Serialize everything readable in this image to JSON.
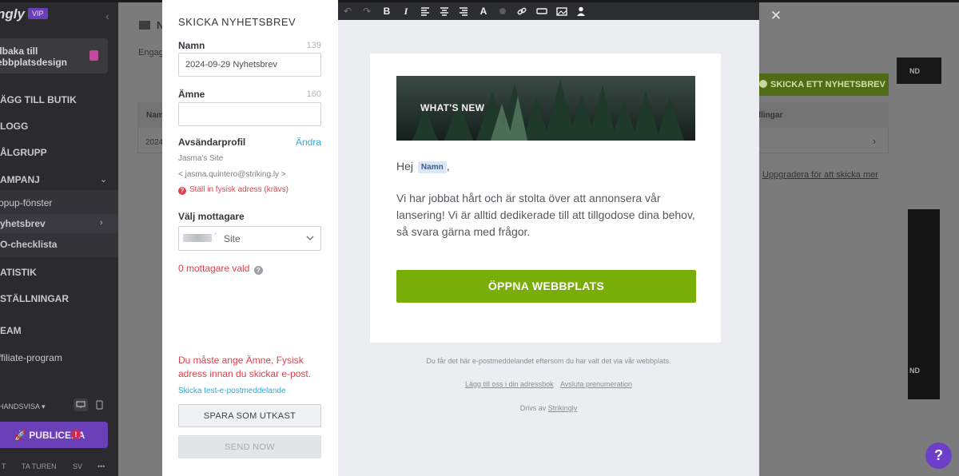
{
  "background_app": {
    "logo": "ngly",
    "vip_badge": "VIP",
    "back_label": "llbaka till ebbplatsdesign",
    "nav": {
      "add_store": "ÄGG TILL BUTIK",
      "blog": "LOGG",
      "audience": "ÅLGRUPP",
      "campaign": "AMPANJ",
      "popup": "opup-fönster",
      "newsletter": "yhetsbrev",
      "seo": "O-checklista",
      "stats": "ATISTIK",
      "settings": "STÄLLNINGAR",
      "team": "EAM",
      "affiliate": "ffiliate-program"
    },
    "preview_label": "HANDSVISA",
    "publish_label": "PUBLICERA",
    "bottom_links": [
      "T",
      "TA TUREN",
      "SV",
      "•••"
    ],
    "header_title": "N",
    "engagement_text": "Engag",
    "table_col_name": "Nam",
    "table_col_actions": "dlingar",
    "table_row_date": "2024",
    "send_newsletter_button": "SKICKA ETT NYHETSBREV",
    "upgrade_link": "Uppgradera för att skicka mer",
    "side_card_text": "ND"
  },
  "editor_toolbar": {
    "buttons": [
      "undo-icon",
      "redo-icon",
      "bold-icon",
      "italic-icon",
      "align-left-icon",
      "align-center-icon",
      "align-right-icon",
      "text-color-icon",
      "dot-icon",
      "link-icon",
      "button-icon",
      "image-icon",
      "person-icon"
    ],
    "bold": "B",
    "italic": "I",
    "font": "A"
  },
  "form": {
    "title": "SKICKA NYHETSBREV",
    "name_label": "Namn",
    "name_count": "139",
    "name_value": "2024-09-29 Nyhetsbrev",
    "subject_label": "Ämne",
    "subject_count": "160",
    "subject_value": "",
    "sender_label": "Avsändarprofil",
    "change_link": "Ändra",
    "sender_name": "Jasma's Site",
    "sender_email": "< jasma.quintero@striking.ly >",
    "address_warning": "Ställ in fysisk adress (krävs)",
    "recipients_label": "Välj mottagare",
    "recipients_select": "Site",
    "recipients_count": "0 mottagare vald",
    "error_message": "Du måste ange Ämne, Fysisk adress innan du skickar e-post.",
    "test_link": "Skicka test-e-postmeddelande",
    "save_draft": "SPARA SOM UTKAST",
    "send_now": "SEND NOW"
  },
  "email": {
    "hero_text": "WHAT'S NEW",
    "greeting": "Hej",
    "name_tag": "Namn",
    "greeting_suffix": ",",
    "body": "Vi har jobbat hårt och är stolta över att annonsera vår lansering! Vi är alltid dedikerade till att tillgodose dina behov, så svara gärna med frågor.",
    "cta": "ÖPPNA WEBBPLATS",
    "footer_note": "Du får det här e-postmeddelandet eftersom du har valt det via vår webbplats.",
    "footer_add": "Lägg till oss i din adressbok",
    "footer_unsub": "Avsluta prenumeration",
    "footer_powered": "Drivs av",
    "footer_brand": "Strikingly"
  },
  "help_fab": "?",
  "colors": {
    "accent_green": "#79ad07",
    "error_red": "#e0414c",
    "link_blue": "#2fa9d9",
    "purple": "#6d3fc8"
  }
}
